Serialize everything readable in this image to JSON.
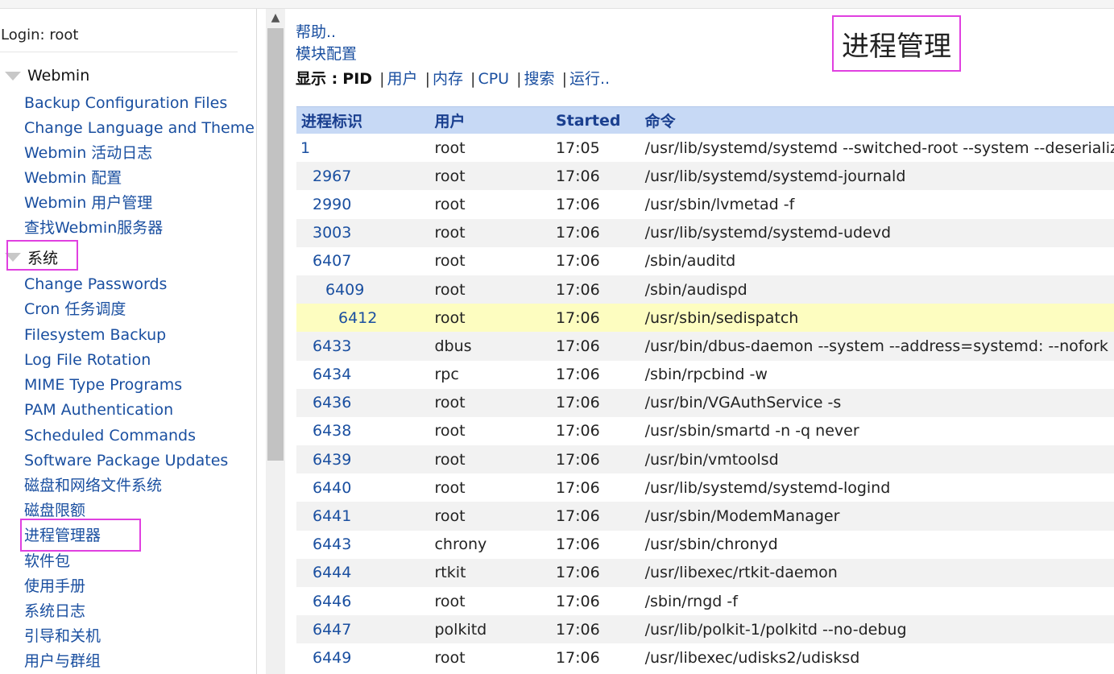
{
  "login": "Login: root",
  "sidebar": {
    "cat_webmin": "Webmin",
    "webmin_items": [
      "Backup Configuration Files",
      "Change Language and Theme",
      "Webmin 活动日志",
      "Webmin 配置",
      "Webmin 用户管理",
      "查找Webmin服务器"
    ],
    "cat_system": "系统",
    "system_items": [
      "Change Passwords",
      "Cron 任务调度",
      "Filesystem Backup",
      "Log File Rotation",
      "MIME Type Programs",
      "PAM Authentication",
      "Scheduled Commands",
      "Software Package Updates",
      "磁盘和网络文件系统",
      "磁盘限额",
      "进程管理器",
      "软件包",
      "使用手册",
      "系统日志",
      "引导和关机",
      "用户与群组"
    ]
  },
  "main": {
    "help_link": "帮助..",
    "module_config_link": "模块配置",
    "title": "进程管理",
    "display": {
      "label": "显示 :",
      "current": "PID",
      "options": [
        "用户",
        "内存",
        "CPU",
        "搜索",
        "运行.."
      ],
      "separator": "|"
    },
    "table": {
      "headers": [
        "进程标识",
        "用户",
        "Started",
        "命令"
      ],
      "rows": [
        {
          "pid": "1",
          "user": "root",
          "started": "17:05",
          "command": "/usr/lib/systemd/systemd --switched-root --system --deserializ"
        },
        {
          "pid": "2967",
          "user": "root",
          "started": "17:06",
          "command": "/usr/lib/systemd/systemd-journald"
        },
        {
          "pid": "2990",
          "user": "root",
          "started": "17:06",
          "command": "/usr/sbin/lvmetad -f"
        },
        {
          "pid": "3003",
          "user": "root",
          "started": "17:06",
          "command": "/usr/lib/systemd/systemd-udevd"
        },
        {
          "pid": "6407",
          "user": "root",
          "started": "17:06",
          "command": "/sbin/auditd"
        },
        {
          "pid": "6409",
          "user": "root",
          "started": "17:06",
          "command": "/sbin/audispd"
        },
        {
          "pid": "6412",
          "user": "root",
          "started": "17:06",
          "command": "/usr/sbin/sedispatch"
        },
        {
          "pid": "6433",
          "user": "dbus",
          "started": "17:06",
          "command": "/usr/bin/dbus-daemon --system --address=systemd: --nofork"
        },
        {
          "pid": "6434",
          "user": "rpc",
          "started": "17:06",
          "command": "/sbin/rpcbind -w"
        },
        {
          "pid": "6436",
          "user": "root",
          "started": "17:06",
          "command": "/usr/bin/VGAuthService -s"
        },
        {
          "pid": "6438",
          "user": "root",
          "started": "17:06",
          "command": "/usr/sbin/smartd -n -q never"
        },
        {
          "pid": "6439",
          "user": "root",
          "started": "17:06",
          "command": "/usr/bin/vmtoolsd"
        },
        {
          "pid": "6440",
          "user": "root",
          "started": "17:06",
          "command": "/usr/lib/systemd/systemd-logind"
        },
        {
          "pid": "6441",
          "user": "root",
          "started": "17:06",
          "command": "/usr/sbin/ModemManager"
        },
        {
          "pid": "6443",
          "user": "chrony",
          "started": "17:06",
          "command": "/usr/sbin/chronyd"
        },
        {
          "pid": "6444",
          "user": "rtkit",
          "started": "17:06",
          "command": "/usr/libexec/rtkit-daemon"
        },
        {
          "pid": "6446",
          "user": "root",
          "started": "17:06",
          "command": "/sbin/rngd -f"
        },
        {
          "pid": "6447",
          "user": "polkitd",
          "started": "17:06",
          "command": "/usr/lib/polkit-1/polkitd --no-debug"
        },
        {
          "pid": "6449",
          "user": "root",
          "started": "17:06",
          "command": "/usr/libexec/udisks2/udisksd"
        }
      ]
    }
  },
  "colors": {
    "link": "#1a4fa0",
    "header_bg": "#c7d9f5",
    "highlight_row": "#fdfdc0",
    "annotation_box": "#e040e0"
  }
}
